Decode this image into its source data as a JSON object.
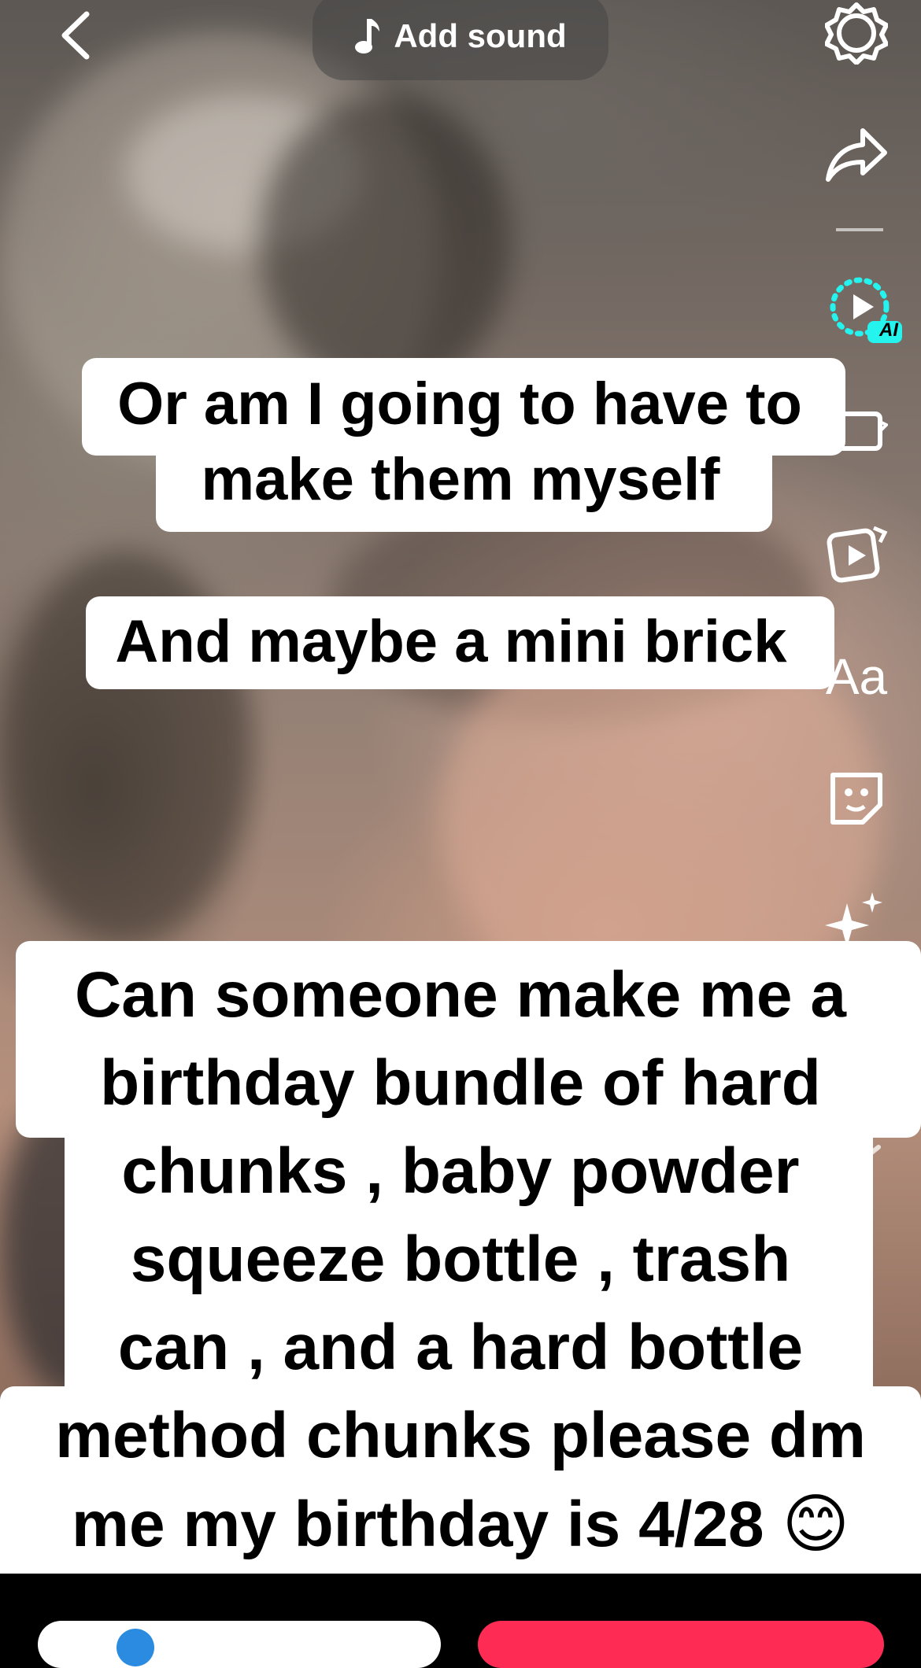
{
  "top_bar": {
    "add_sound_label": "Add sound"
  },
  "right_rail": {
    "icons": [
      "gear-icon",
      "share-icon",
      "ai-effects-icon",
      "template-icon",
      "edit-clip-icon",
      "text-icon",
      "sticker-icon",
      "effects-icon",
      "filters-icon",
      "more-chevron-icon"
    ],
    "text_tool_label": "Aa",
    "ai_badge": "AI"
  },
  "captions": {
    "caption1": {
      "line1": "Or am I going to have to",
      "line2": "make them myself"
    },
    "caption2": {
      "line1": "And maybe a mini brick"
    },
    "caption3": {
      "line1": "Can someone make me a",
      "line2": "birthday bundle of hard",
      "line3": "chunks , baby powder",
      "line4": "squeeze bottle , trash",
      "line5": "can , and a hard bottle",
      "line6": "method chunks please dm",
      "line7": "me my birthday is 4/28 😊"
    }
  },
  "colors": {
    "accent_ai": "#25f4ee",
    "post_button": "#fe2c55"
  }
}
